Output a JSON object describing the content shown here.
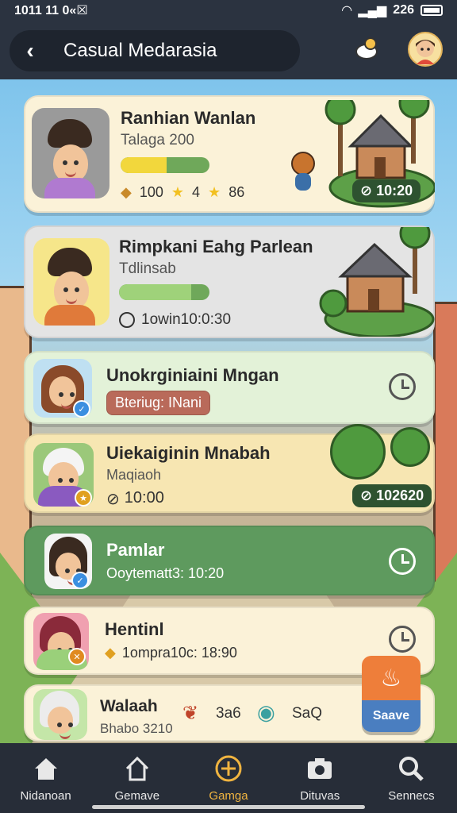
{
  "status_bar": {
    "time": "1011 11 0«☒",
    "signal_text": "⊙⊙⊙",
    "battery_text": "226"
  },
  "header": {
    "title": "Casual Medarasia",
    "back_icon": "chevron-left-icon",
    "bell_icon": "bell-icon",
    "avatar_icon": "user-avatar-icon"
  },
  "cards": [
    {
      "name": "Ranhian Wanlan",
      "sub": "Talaga 200",
      "progress": 0.4,
      "stats": [
        "100",
        "4",
        "86"
      ],
      "time_chip": "10:20"
    },
    {
      "name": "Rimpkani Eahg Parlean",
      "sub": "Tdlinsab",
      "progress": 0.5,
      "time_text": "1owin10:0:30"
    },
    {
      "name": "Unokrginiaini Mngan",
      "tag": "Bteriug: INani"
    },
    {
      "name": "Uiekaiginin Mnabah",
      "sub": "Maqiaoh",
      "time_text": "10:00",
      "time_chip": "102620"
    },
    {
      "name": "Pamlar",
      "sub": "Ooytematt3: 10:20"
    },
    {
      "name": "Hentinl",
      "sub": "1ompra10c: 18:90"
    },
    {
      "name": "Walaah",
      "sub": "Bhabo 3210",
      "stat_a": "3a6",
      "stat_b": "SaQ"
    }
  ],
  "save_button": {
    "label": "Saave"
  },
  "nav": [
    {
      "label": "Nidanoan",
      "icon": "home-icon"
    },
    {
      "label": "Gemave",
      "icon": "house-outline-icon"
    },
    {
      "label": "Gamga",
      "icon": "plus-circle-icon"
    },
    {
      "label": "Dituvas",
      "icon": "camera-icon"
    },
    {
      "label": "Sennecs",
      "icon": "search-icon"
    }
  ],
  "colors": {
    "accent": "#f0b440",
    "header": "#2b3340",
    "green_card": "#5e9a5e"
  }
}
